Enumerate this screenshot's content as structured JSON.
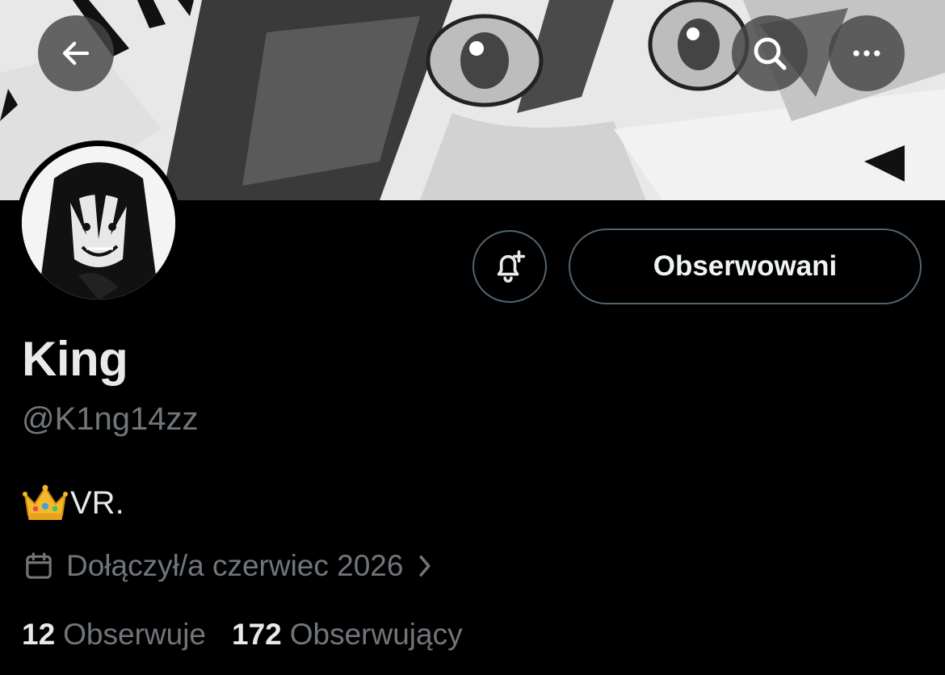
{
  "header": {
    "back_icon": "arrow-left-icon",
    "search_icon": "search-icon",
    "more_icon": "more-horizontal-icon"
  },
  "profile": {
    "name": "King",
    "handle": "@K1ng14zz",
    "bio_emoji": "crown-emoji",
    "bio_text": "VR.",
    "joined_text": "Dołączył/a czerwiec 2026",
    "follow_button_label": "Obserwowani",
    "notify_icon": "bell-plus-icon"
  },
  "stats": {
    "following_count": "12",
    "following_label": "Obserwuje",
    "followers_count": "172",
    "followers_label": "Obserwujący"
  },
  "colors": {
    "background": "#000000",
    "primary_text": "#e7e9ea",
    "secondary_text": "#71767b",
    "button_border": "#536471"
  }
}
